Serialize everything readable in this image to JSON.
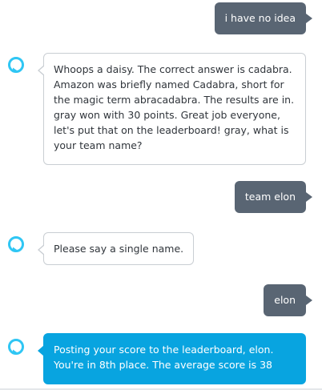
{
  "colors": {
    "user_bubble": "#596573",
    "alexa_bubble_border": "#c9ced3",
    "alexa_active_bubble": "#08a4e0",
    "avatar_ring": "#2fc6f4"
  },
  "conversation": [
    {
      "speaker": "user",
      "text": "i have no idea"
    },
    {
      "speaker": "alexa",
      "icon": "alexa-ring-icon",
      "text": "Whoops a daisy. The correct answer is cadabra. Amazon was briefly named Cadabra, short for the magic term abracadabra. The results are in. gray won with 30 points. Great job everyone, let's put that on the leaderboard! gray, what is your team name?"
    },
    {
      "speaker": "user",
      "text": "team elon"
    },
    {
      "speaker": "alexa",
      "icon": "alexa-ring-icon",
      "text": "Please say a single name."
    },
    {
      "speaker": "user",
      "text": "elon"
    },
    {
      "speaker": "alexa",
      "icon": "alexa-ring-icon",
      "text": "Posting your score to the leaderboard, elon. You're in 8th place. The average score is 38",
      "active": true
    }
  ]
}
